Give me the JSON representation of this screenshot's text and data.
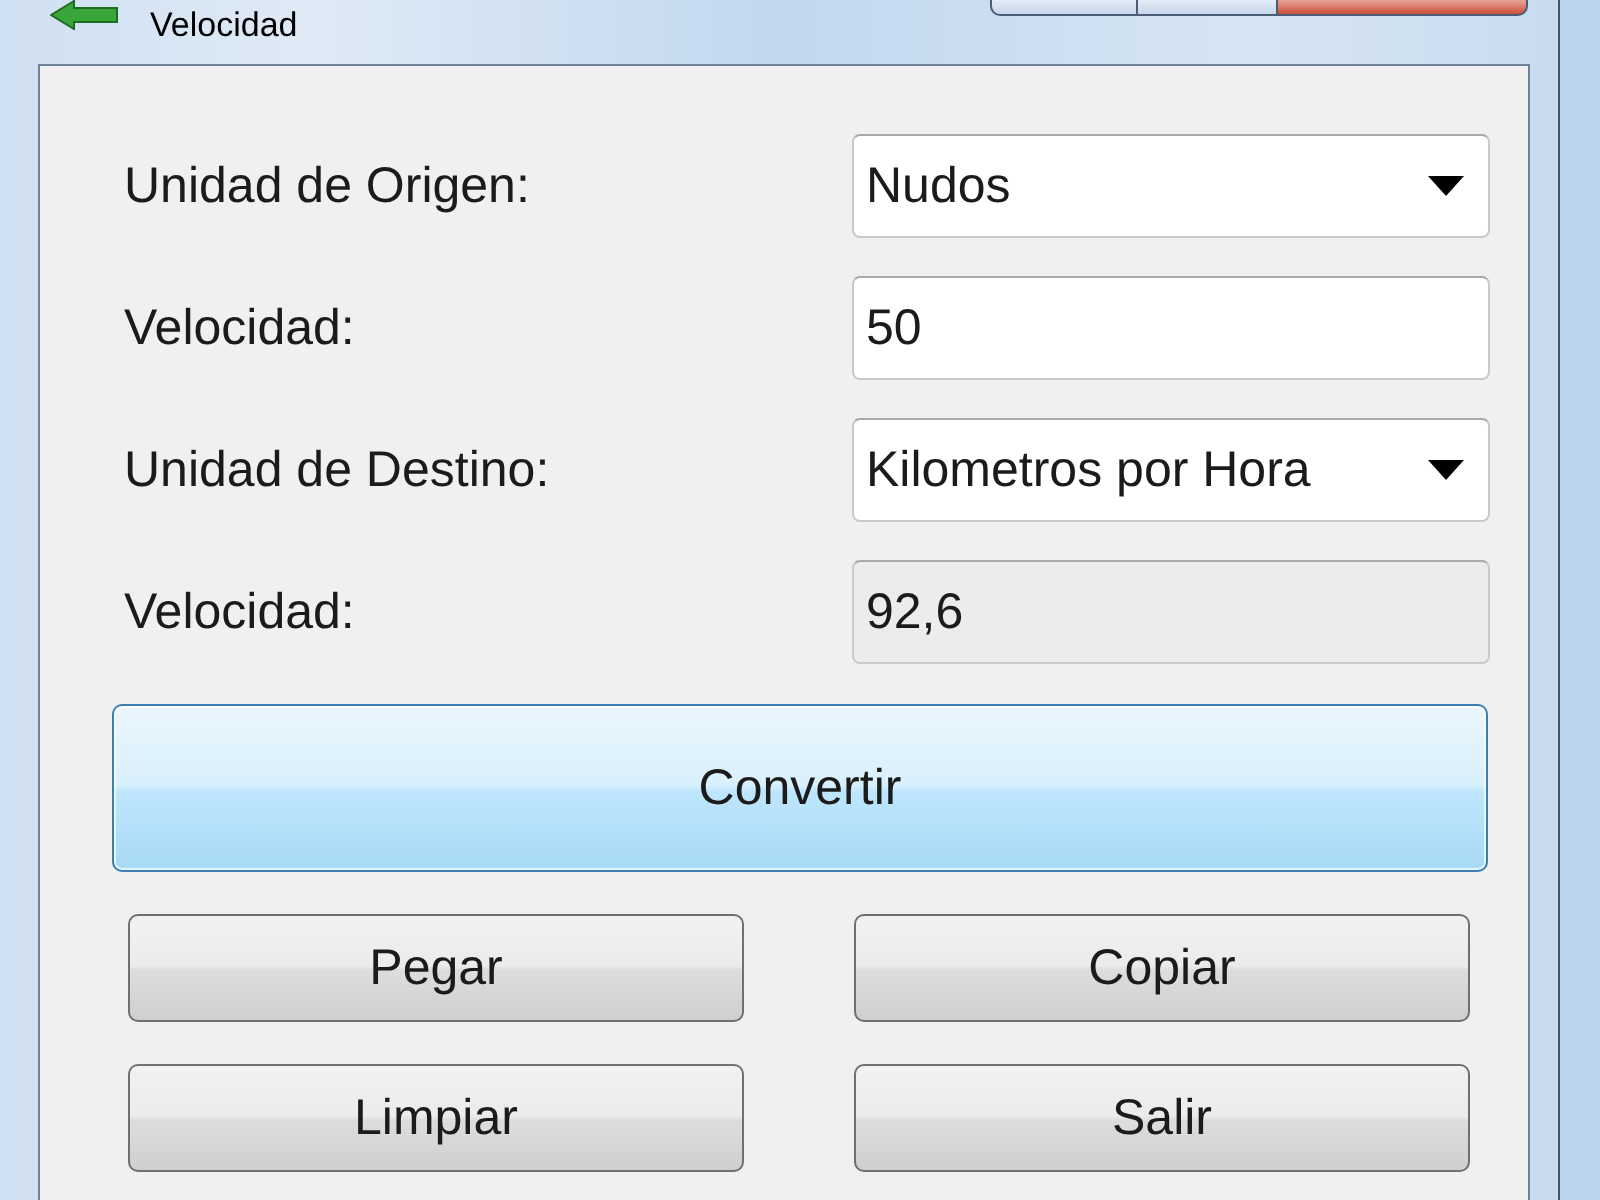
{
  "window": {
    "title": "Velocidad"
  },
  "fields": [
    {
      "kind": "dropdown",
      "label": "Unidad de Origen:",
      "value": "Nudos"
    },
    {
      "kind": "input",
      "label": "Velocidad:",
      "value": "50"
    },
    {
      "kind": "dropdown",
      "label": "Unidad de Destino:",
      "value": "Kilometros por Hora"
    },
    {
      "kind": "readonly",
      "label": "Velocidad:",
      "value": "92,6"
    }
  ],
  "buttons": [
    {
      "kind": "wide",
      "label": "Convertir",
      "highlighted": true
    },
    {
      "kind": "half",
      "label": "Pegar",
      "highlighted": false
    },
    {
      "kind": "half",
      "label": "Copiar",
      "highlighted": false
    },
    {
      "kind": "half",
      "label": "Limpiar",
      "highlighted": false
    },
    {
      "kind": "half",
      "label": "Salir",
      "highlighted": false
    }
  ]
}
